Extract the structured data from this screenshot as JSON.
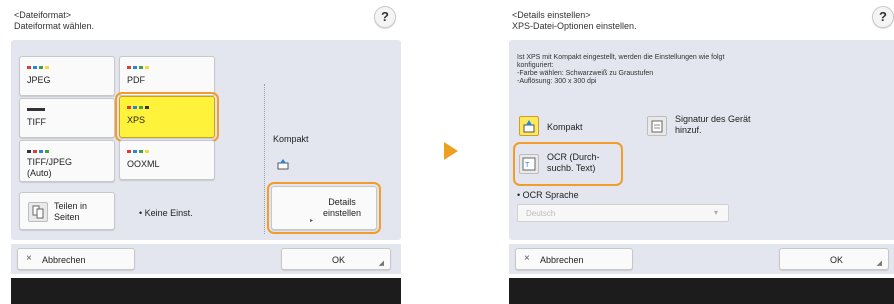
{
  "left": {
    "header_line1": "<Dateiformat>",
    "header_line2": "Dateiformat wählen.",
    "help_label": "?",
    "formats": {
      "jpeg": "JPEG",
      "pdf": "PDF",
      "tiff": "TIFF",
      "xps": "XPS",
      "tiff_jpeg": "TIFF/JPEG (Auto)",
      "ooxml": "OOXML"
    },
    "split_pages": "Teilen in Seiten",
    "no_setting": "• Keine Einst.",
    "compact_label": "Kompakt",
    "details_button": "Details einstellen",
    "cancel_label": "Abbrechen",
    "ok_label": "OK"
  },
  "right": {
    "header_line1": "<Details einstellen>",
    "header_line2": "XPS-Datei-Optionen einstellen.",
    "help_label": "?",
    "info_line1": "Ist XPS mit Kompakt eingestellt, werden die Einstellungen wie folgt",
    "info_line2": "konfiguriert:",
    "info_line3": "-Farbe wählen: Schwarzweiß zu Graustufen",
    "info_line4": "-Auflösung: 300 x 300 dpi",
    "compact_button": "Kompakt",
    "signature_button": "Signatur des Gerät hinzuf.",
    "ocr_button": "OCR (Durch-suchb. Text)",
    "ocr_language_label": "• OCR Sprache",
    "ocr_language_value": "Deutsch",
    "cancel_label": "Abbrechen",
    "ok_label": "OK"
  },
  "colors": {
    "selected": "#fff23a",
    "highlight_ring": "#f39c2c",
    "arrow": "#f0a020",
    "panel_bg": "#e3e6ee"
  },
  "icons": [
    "help-icon",
    "close-icon",
    "compact-icon",
    "split-icon",
    "signature-icon",
    "ocr-icon",
    "chevron-down-icon",
    "next-arrow-icon",
    "resize-corner-icon"
  ]
}
